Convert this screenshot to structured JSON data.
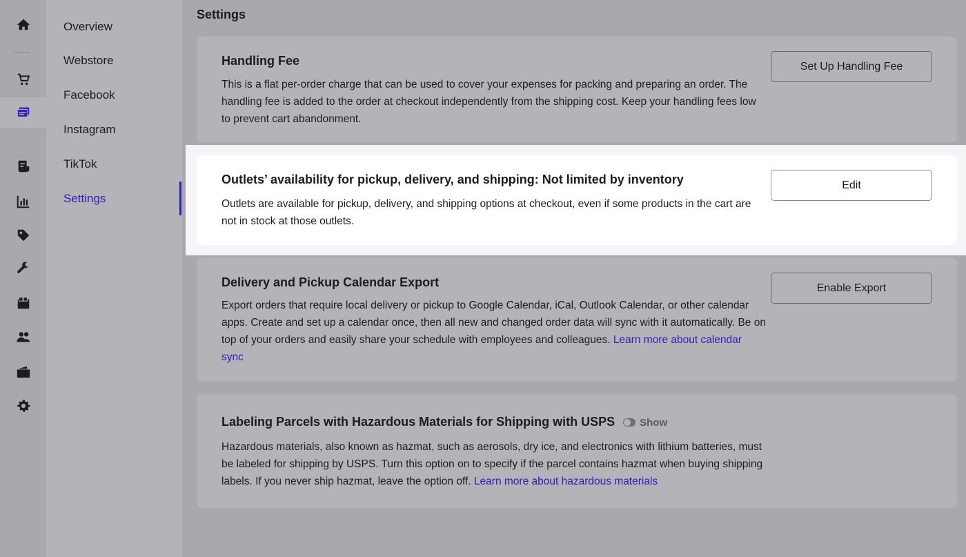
{
  "rail": {
    "items": [
      {
        "icon": "home-icon"
      },
      {
        "icon": "cart-icon"
      },
      {
        "icon": "sales-channels-icon",
        "active": true
      },
      {
        "icon": "invoice-icon"
      },
      {
        "icon": "reports-icon"
      },
      {
        "icon": "tag-icon"
      },
      {
        "icon": "wrench-icon"
      },
      {
        "icon": "apps-icon"
      },
      {
        "icon": "customers-icon"
      },
      {
        "icon": "wallet-icon"
      },
      {
        "icon": "gear-icon"
      }
    ]
  },
  "subnav": {
    "items": [
      {
        "label": "Overview"
      },
      {
        "label": "Webstore"
      },
      {
        "label": "Facebook"
      },
      {
        "label": "Instagram"
      },
      {
        "label": "TikTok"
      },
      {
        "label": "Settings",
        "active": true
      }
    ]
  },
  "page": {
    "title": "Settings"
  },
  "cards": {
    "handling": {
      "title": "Handling Fee",
      "desc": "This is a flat per-order charge that can be used to cover your expenses for packing and preparing an order. The handling fee is added to the order at checkout independently from the shipping cost. Keep your handling fees low to prevent cart abandonment.",
      "button": "Set Up Handling Fee"
    },
    "outlets": {
      "title": "Outlets’ availability for pickup, delivery, and shipping: Not limited by inventory",
      "desc": "Outlets are available for pickup, delivery, and shipping options at checkout, even if some products in the cart are not in stock at those outlets.",
      "button": "Edit"
    },
    "calendar": {
      "title": "Delivery and Pickup Calendar Export",
      "desc": "Export orders that require local delivery or pickup to Google Calendar, iCal, Outlook Calendar, or other calendar apps. Create and set up a calendar once, then all new and changed order data will sync with it automatically. Be on top of your orders and easily share your schedule with employees and colleagues. ",
      "link": "Learn more about calendar sync",
      "button": "Enable Export"
    },
    "hazmat": {
      "title": "Labeling Parcels with Hazardous Materials for Shipping with USPS",
      "toggle_label": "Show",
      "desc": "Hazardous materials, also known as hazmat, such as aerosols, dry ice, and electronics with lithium batteries, must be labeled for shipping by USPS. Turn this option on to specify if the parcel contains hazmat when buying shipping labels. If you never ship hazmat, leave the option off. ",
      "link": "Learn more about hazardous materials"
    }
  },
  "colors": {
    "accent": "#2b20b8",
    "overlay": "#a9a9ad",
    "card": "#b4b4b8"
  }
}
